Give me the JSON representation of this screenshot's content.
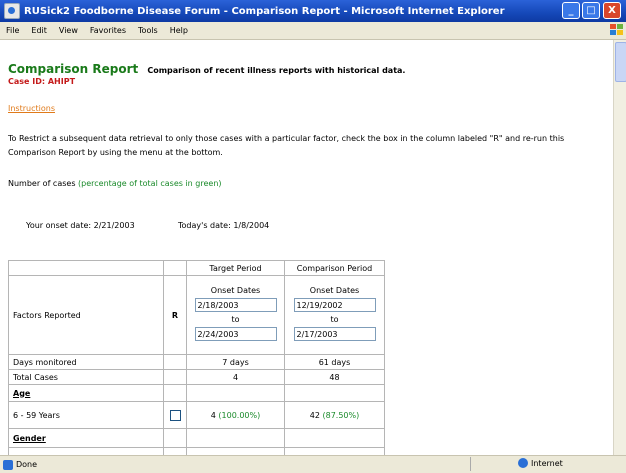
{
  "window": {
    "title": "RUSick2 Foodborne Disease Forum - Comparison Report - Microsoft Internet Explorer",
    "minimize": "_",
    "maximize": "□",
    "close": "X"
  },
  "menu": [
    "File",
    "Edit",
    "View",
    "Favorites",
    "Tools",
    "Help"
  ],
  "page": {
    "title": "Comparison Report",
    "subtitle": "Comparison of recent illness reports with historical data.",
    "case_id": "Case ID:  AHIPT",
    "instructions_link": "Instructions",
    "paragraph": "To Restrict a subsequent data retrieval to only those cases with a particular factor, check the box in the column labeled \"R\" and re-run this Comparison Report by using the menu at the bottom.",
    "number_of_cases": "Number of cases ",
    "number_of_cases_note": "(percentage of total cases in green)",
    "onset_date": "Your onset date:  2/21/2003",
    "todays_date": "Today's date:  1/8/2004"
  },
  "table": {
    "col_target": "Target Period",
    "col_comparison": "Comparison Period",
    "factors_reported": "Factors Reported",
    "r_label": "R",
    "onset_dates": "Onset Dates",
    "to": "to",
    "target_start": "2/18/2003",
    "target_end": "2/24/2003",
    "comparison_start": "12/19/2002",
    "comparison_end": "2/17/2003",
    "days_monitored_label": "Days monitored",
    "days_target": "7 days",
    "days_comparison": "61 days",
    "total_cases_label": "Total Cases",
    "total_target": "4",
    "total_comparison": "48",
    "age_label": "Age",
    "age_group_label": "6 - 59 Years",
    "age_target_count": "4 ",
    "age_target_pct": "(100.00%)",
    "age_comparison_count": "42 ",
    "age_comparison_pct": "(87.50%)",
    "gender_label": "Gender"
  },
  "status": {
    "left": "Done",
    "zone": "Internet"
  }
}
